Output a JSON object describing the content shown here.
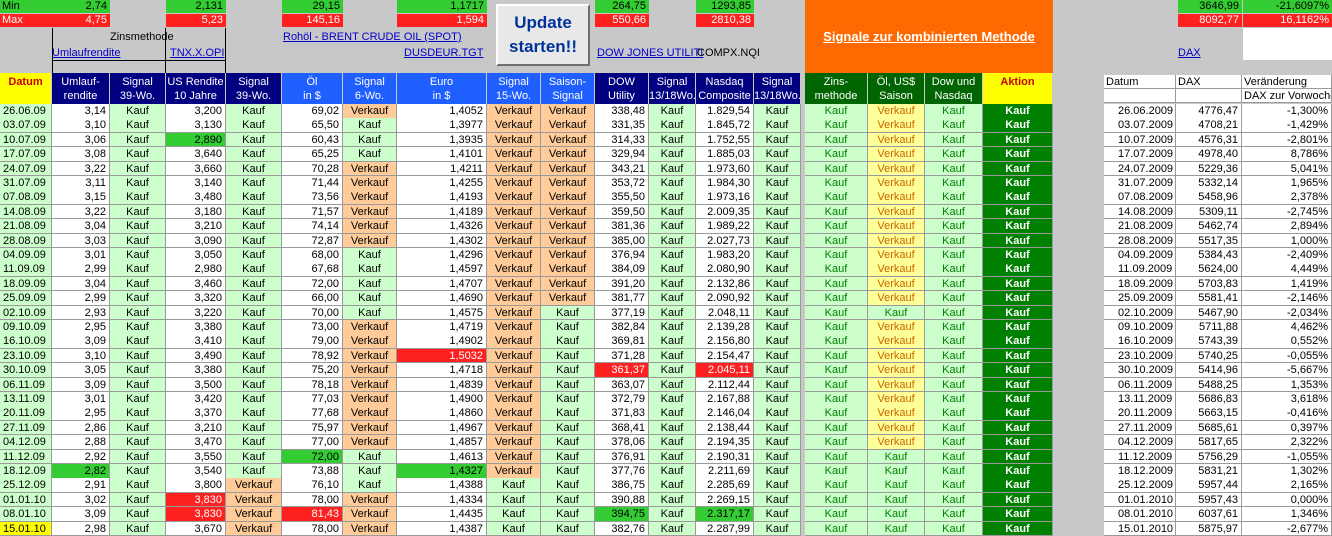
{
  "top": {
    "min_label": "Min",
    "max_label": "Max",
    "min": [
      "2,74",
      "2,131",
      "29,15",
      "1,1717",
      "264,75",
      "1293,85",
      "3646,99",
      "-21,6097%"
    ],
    "max": [
      "4,75",
      "5,23",
      "145,16",
      "1,594",
      "550,66",
      "2810,38",
      "8092,77",
      "16,1162%"
    ],
    "zinsmethode": "Zinsmethode",
    "links": {
      "umlauf": "Umlaufrendite",
      "tnx": "TNX.X.OPI",
      "brent": "Rohöl - BRENT CRUDE OIL (SPOT)",
      "usdeur": "DUSDEUR.TGT",
      "dow": "DOW JONES UTILITI",
      "compx": "COMPX.NQI",
      "dax": "DAX"
    },
    "update_button": "Update starten!!",
    "banner": "Signale zur kombinierten Methode"
  },
  "headers": [
    "Datum",
    "Umlauf-\nrendite",
    "Signal\n39-Wo.",
    "US Rendite\n10 Jahre",
    "Signal\n39-Wo.",
    "Öl\nin $",
    "Signal\n6-Wo.",
    "Euro\nin $",
    "Signal\n15-Wo.",
    "Saison-\nSignal",
    "DOW\nUtility",
    "Signal\n13/18Wo.",
    "Nasdaq\nComposite",
    "Signal\n13/18Wo.",
    "Zins-\nmethode",
    "Öl, US$\nSaison",
    "Dow und\nNasdaq",
    "Aktion"
  ],
  "rows": [
    [
      "26.06.09",
      "3,14",
      "Kauf",
      "3,200",
      "Kauf",
      "69,02",
      "Verkauf",
      "1,4052",
      "Verkauf",
      "Verkauf",
      "338,48",
      "Kauf",
      "1.829,54",
      "Kauf",
      "Kauf",
      "Verkauf",
      "Kauf",
      "Kauf"
    ],
    [
      "03.07.09",
      "3,10",
      "Kauf",
      "3,130",
      "Kauf",
      "65,50",
      "Kauf",
      "1,3977",
      "Verkauf",
      "Verkauf",
      "331,35",
      "Kauf",
      "1.845,72",
      "Kauf",
      "Kauf",
      "Verkauf",
      "Kauf",
      "Kauf"
    ],
    [
      "10.07.09",
      "3,06",
      "Kauf",
      "2,890",
      "Kauf",
      "60,43",
      "Kauf",
      "1,3935",
      "Verkauf",
      "Verkauf",
      "314,33",
      "Kauf",
      "1.752,55",
      "Kauf",
      "Kauf",
      "Verkauf",
      "Kauf",
      "Kauf"
    ],
    [
      "17.07.09",
      "3,08",
      "Kauf",
      "3,640",
      "Kauf",
      "65,25",
      "Kauf",
      "1,4101",
      "Verkauf",
      "Verkauf",
      "329,94",
      "Kauf",
      "1.885,03",
      "Kauf",
      "Kauf",
      "Verkauf",
      "Kauf",
      "Kauf"
    ],
    [
      "24.07.09",
      "3,22",
      "Kauf",
      "3,660",
      "Kauf",
      "70,28",
      "Verkauf",
      "1,4211",
      "Verkauf",
      "Verkauf",
      "343,21",
      "Kauf",
      "1.973,60",
      "Kauf",
      "Kauf",
      "Verkauf",
      "Kauf",
      "Kauf"
    ],
    [
      "31.07.09",
      "3,11",
      "Kauf",
      "3,140",
      "Kauf",
      "71,44",
      "Verkauf",
      "1,4255",
      "Verkauf",
      "Verkauf",
      "353,72",
      "Kauf",
      "1.984,30",
      "Kauf",
      "Kauf",
      "Verkauf",
      "Kauf",
      "Kauf"
    ],
    [
      "07.08.09",
      "3,15",
      "Kauf",
      "3,480",
      "Kauf",
      "73,56",
      "Verkauf",
      "1,4193",
      "Verkauf",
      "Verkauf",
      "355,50",
      "Kauf",
      "1.973,16",
      "Kauf",
      "Kauf",
      "Verkauf",
      "Kauf",
      "Kauf"
    ],
    [
      "14.08.09",
      "3,22",
      "Kauf",
      "3,180",
      "Kauf",
      "71,57",
      "Verkauf",
      "1,4189",
      "Verkauf",
      "Verkauf",
      "359,50",
      "Kauf",
      "2.009,35",
      "Kauf",
      "Kauf",
      "Verkauf",
      "Kauf",
      "Kauf"
    ],
    [
      "21.08.09",
      "3,04",
      "Kauf",
      "3,210",
      "Kauf",
      "74,14",
      "Verkauf",
      "1,4326",
      "Verkauf",
      "Verkauf",
      "381,36",
      "Kauf",
      "1.989,22",
      "Kauf",
      "Kauf",
      "Verkauf",
      "Kauf",
      "Kauf"
    ],
    [
      "28.08.09",
      "3,03",
      "Kauf",
      "3,090",
      "Kauf",
      "72,87",
      "Verkauf",
      "1,4302",
      "Verkauf",
      "Verkauf",
      "385,00",
      "Kauf",
      "2.027,73",
      "Kauf",
      "Kauf",
      "Verkauf",
      "Kauf",
      "Kauf"
    ],
    [
      "04.09.09",
      "3,01",
      "Kauf",
      "3,050",
      "Kauf",
      "68,00",
      "Kauf",
      "1,4296",
      "Verkauf",
      "Verkauf",
      "376,94",
      "Kauf",
      "1.983,20",
      "Kauf",
      "Kauf",
      "Verkauf",
      "Kauf",
      "Kauf"
    ],
    [
      "11.09.09",
      "2,99",
      "Kauf",
      "2,980",
      "Kauf",
      "67,68",
      "Kauf",
      "1,4597",
      "Verkauf",
      "Verkauf",
      "384,09",
      "Kauf",
      "2.080,90",
      "Kauf",
      "Kauf",
      "Verkauf",
      "Kauf",
      "Kauf"
    ],
    [
      "18.09.09",
      "3,04",
      "Kauf",
      "3,460",
      "Kauf",
      "72,00",
      "Kauf",
      "1,4707",
      "Verkauf",
      "Verkauf",
      "391,20",
      "Kauf",
      "2.132,86",
      "Kauf",
      "Kauf",
      "Verkauf",
      "Kauf",
      "Kauf"
    ],
    [
      "25.09.09",
      "2,99",
      "Kauf",
      "3,320",
      "Kauf",
      "66,00",
      "Kauf",
      "1,4690",
      "Verkauf",
      "Verkauf",
      "381,77",
      "Kauf",
      "2.090,92",
      "Kauf",
      "Kauf",
      "Verkauf",
      "Kauf",
      "Kauf"
    ],
    [
      "02.10.09",
      "2,93",
      "Kauf",
      "3,220",
      "Kauf",
      "70,00",
      "Kauf",
      "1,4575",
      "Verkauf",
      "Kauf",
      "377,19",
      "Kauf",
      "2.048,11",
      "Kauf",
      "Kauf",
      "Kauf",
      "Kauf",
      "Kauf"
    ],
    [
      "09.10.09",
      "2,95",
      "Kauf",
      "3,380",
      "Kauf",
      "73,00",
      "Verkauf",
      "1,4719",
      "Verkauf",
      "Kauf",
      "382,84",
      "Kauf",
      "2.139,28",
      "Kauf",
      "Kauf",
      "Verkauf",
      "Kauf",
      "Kauf"
    ],
    [
      "16.10.09",
      "3,09",
      "Kauf",
      "3,410",
      "Kauf",
      "79,00",
      "Verkauf",
      "1,4902",
      "Verkauf",
      "Kauf",
      "369,81",
      "Kauf",
      "2.156,80",
      "Kauf",
      "Kauf",
      "Verkauf",
      "Kauf",
      "Kauf"
    ],
    [
      "23.10.09",
      "3,10",
      "Kauf",
      "3,490",
      "Kauf",
      "78,92",
      "Verkauf",
      "1,5032",
      "Verkauf",
      "Kauf",
      "371,28",
      "Kauf",
      "2.154,47",
      "Kauf",
      "Kauf",
      "Verkauf",
      "Kauf",
      "Kauf"
    ],
    [
      "30.10.09",
      "3,05",
      "Kauf",
      "3,380",
      "Kauf",
      "75,20",
      "Verkauf",
      "1,4718",
      "Verkauf",
      "Kauf",
      "361,37",
      "Kauf",
      "2.045,11",
      "Kauf",
      "Kauf",
      "Verkauf",
      "Kauf",
      "Kauf"
    ],
    [
      "06.11.09",
      "3,09",
      "Kauf",
      "3,500",
      "Kauf",
      "78,18",
      "Verkauf",
      "1,4839",
      "Verkauf",
      "Kauf",
      "363,07",
      "Kauf",
      "2.112,44",
      "Kauf",
      "Kauf",
      "Verkauf",
      "Kauf",
      "Kauf"
    ],
    [
      "13.11.09",
      "3,01",
      "Kauf",
      "3,420",
      "Kauf",
      "77,03",
      "Verkauf",
      "1,4900",
      "Verkauf",
      "Kauf",
      "372,79",
      "Kauf",
      "2.167,88",
      "Kauf",
      "Kauf",
      "Verkauf",
      "Kauf",
      "Kauf"
    ],
    [
      "20.11.09",
      "2,95",
      "Kauf",
      "3,370",
      "Kauf",
      "77,68",
      "Verkauf",
      "1,4860",
      "Verkauf",
      "Kauf",
      "371,83",
      "Kauf",
      "2.146,04",
      "Kauf",
      "Kauf",
      "Verkauf",
      "Kauf",
      "Kauf"
    ],
    [
      "27.11.09",
      "2,86",
      "Kauf",
      "3,210",
      "Kauf",
      "75,97",
      "Verkauf",
      "1,4967",
      "Verkauf",
      "Kauf",
      "368,41",
      "Kauf",
      "2.138,44",
      "Kauf",
      "Kauf",
      "Verkauf",
      "Kauf",
      "Kauf"
    ],
    [
      "04.12.09",
      "2,88",
      "Kauf",
      "3,470",
      "Kauf",
      "77,00",
      "Verkauf",
      "1,4857",
      "Verkauf",
      "Kauf",
      "378,06",
      "Kauf",
      "2.194,35",
      "Kauf",
      "Kauf",
      "Verkauf",
      "Kauf",
      "Kauf"
    ],
    [
      "11.12.09",
      "2,92",
      "Kauf",
      "3,550",
      "Kauf",
      "72,00",
      "Kauf",
      "1,4613",
      "Verkauf",
      "Kauf",
      "376,91",
      "Kauf",
      "2.190,31",
      "Kauf",
      "Kauf",
      "Kauf",
      "Kauf",
      "Kauf"
    ],
    [
      "18.12.09",
      "2,82",
      "Kauf",
      "3,540",
      "Kauf",
      "73,88",
      "Kauf",
      "1,4327",
      "Verkauf",
      "Kauf",
      "377,76",
      "Kauf",
      "2.211,69",
      "Kauf",
      "Kauf",
      "Kauf",
      "Kauf",
      "Kauf"
    ],
    [
      "25.12.09",
      "2,91",
      "Kauf",
      "3,800",
      "Verkauf",
      "76,10",
      "Kauf",
      "1,4388",
      "Kauf",
      "Kauf",
      "386,75",
      "Kauf",
      "2.285,69",
      "Kauf",
      "Kauf",
      "Kauf",
      "Kauf",
      "Kauf"
    ],
    [
      "01.01.10",
      "3,02",
      "Kauf",
      "3,830",
      "Verkauf",
      "78,00",
      "Verkauf",
      "1,4334",
      "Kauf",
      "Kauf",
      "390,88",
      "Kauf",
      "2.269,15",
      "Kauf",
      "Kauf",
      "Kauf",
      "Kauf",
      "Kauf"
    ],
    [
      "08.01.10",
      "3,09",
      "Kauf",
      "3,830",
      "Verkauf",
      "81,43",
      "Verkauf",
      "1,4435",
      "Kauf",
      "Kauf",
      "394,75",
      "Kauf",
      "2.317,17",
      "Kauf",
      "Kauf",
      "Kauf",
      "Kauf",
      "Kauf"
    ],
    [
      "15.01.10",
      "2,98",
      "Kauf",
      "3,670",
      "Verkauf",
      "78,00",
      "Verkauf",
      "1,4387",
      "Kauf",
      "Kauf",
      "382,76",
      "Kauf",
      "2.287,99",
      "Kauf",
      "Kauf",
      "Kauf",
      "Kauf",
      "Kauf"
    ]
  ],
  "highlights": {
    "red": [
      [
        28,
        3
      ],
      [
        27,
        3
      ],
      [
        17,
        7
      ],
      [
        18,
        10
      ],
      [
        18,
        12
      ],
      [
        28,
        5
      ]
    ],
    "green": [
      [
        2,
        3
      ],
      [
        24,
        5
      ],
      [
        25,
        1
      ],
      [
        25,
        7
      ],
      [
        28,
        10
      ],
      [
        28,
        12
      ]
    ]
  },
  "right": {
    "headers": [
      "Datum",
      "DAX",
      "Veränderung"
    ],
    "sub": "DAX zur Vorwoche",
    "rows": [
      [
        "26.06.2009",
        "4776,47",
        "-1,300%"
      ],
      [
        "03.07.2009",
        "4708,21",
        "-1,429%"
      ],
      [
        "10.07.2009",
        "4576,31",
        "-2,801%"
      ],
      [
        "17.07.2009",
        "4978,40",
        "8,786%"
      ],
      [
        "24.07.2009",
        "5229,36",
        "5,041%"
      ],
      [
        "31.07.2009",
        "5332,14",
        "1,965%"
      ],
      [
        "07.08.2009",
        "5458,96",
        "2,378%"
      ],
      [
        "14.08.2009",
        "5309,11",
        "-2,745%"
      ],
      [
        "21.08.2009",
        "5462,74",
        "2,894%"
      ],
      [
        "28.08.2009",
        "5517,35",
        "1,000%"
      ],
      [
        "04.09.2009",
        "5384,43",
        "-2,409%"
      ],
      [
        "11.09.2009",
        "5624,00",
        "4,449%"
      ],
      [
        "18.09.2009",
        "5703,83",
        "1,419%"
      ],
      [
        "25.09.2009",
        "5581,41",
        "-2,146%"
      ],
      [
        "02.10.2009",
        "5467,90",
        "-2,034%"
      ],
      [
        "09.10.2009",
        "5711,88",
        "4,462%"
      ],
      [
        "16.10.2009",
        "5743,39",
        "0,552%"
      ],
      [
        "23.10.2009",
        "5740,25",
        "-0,055%"
      ],
      [
        "30.10.2009",
        "5414,96",
        "-5,667%"
      ],
      [
        "06.11.2009",
        "5488,25",
        "1,353%"
      ],
      [
        "13.11.2009",
        "5686,83",
        "3,618%"
      ],
      [
        "20.11.2009",
        "5663,15",
        "-0,416%"
      ],
      [
        "27.11.2009",
        "5685,61",
        "0,397%"
      ],
      [
        "04.12.2009",
        "5817,65",
        "2,322%"
      ],
      [
        "11.12.2009",
        "5756,29",
        "-1,055%"
      ],
      [
        "18.12.2009",
        "5831,21",
        "1,302%"
      ],
      [
        "25.12.2009",
        "5957,44",
        "2,165%"
      ],
      [
        "01.01.2010",
        "5957,43",
        "0,000%"
      ],
      [
        "08.01.2010",
        "6037,61",
        "1,346%"
      ],
      [
        "15.01.2010",
        "5875,97",
        "-2,677%"
      ]
    ]
  },
  "colors": {
    "navy": "#000080",
    "blue": "#1f5fff",
    "green": "#006400",
    "kauf": "#ccffcc",
    "verkauf": "#ffcc99",
    "orange": "#ff6a00",
    "red": "#ff2020",
    "bright_green": "#33cc33"
  }
}
